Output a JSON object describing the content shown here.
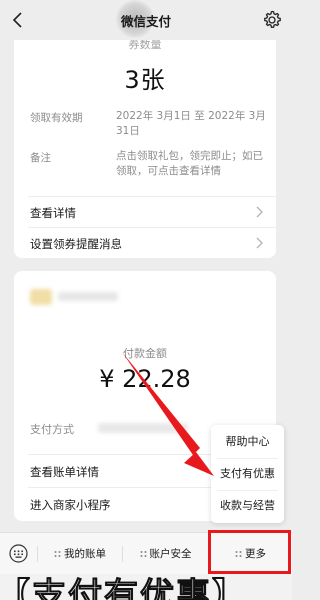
{
  "header": {
    "title": "微信支付",
    "back_icon": "chevron-left-icon",
    "settings_icon": "gear-icon"
  },
  "coupon_card": {
    "count_label": "券数量",
    "count_value": "3张",
    "validity_label": "领取有效期",
    "validity_value": "2022年 3月1日 至 2022年 3月31日",
    "note_label": "备注",
    "note_value": "点击领取礼包，领完即止；如已领取，可点击查看详情",
    "links": [
      {
        "label": "查看详情"
      },
      {
        "label": "设置领券提醒消息"
      }
    ]
  },
  "payment_card": {
    "amount_label": "付款金额",
    "amount_value": "¥ 22.28",
    "method_label": "支付方式",
    "links": [
      {
        "label": "查看账单详情"
      },
      {
        "label": "进入商家小程序"
      }
    ]
  },
  "popup_menu": {
    "items": [
      {
        "label": "帮助中心"
      },
      {
        "label": "支付有优惠"
      },
      {
        "label": "收款与经营"
      }
    ]
  },
  "bottom_bar": {
    "keyboard_icon": "keyboard-icon",
    "items": [
      {
        "label": "我的账单"
      },
      {
        "label": "账户安全"
      },
      {
        "label": "更多"
      }
    ]
  },
  "caption": {
    "text": "【支付有优惠】"
  },
  "colors": {
    "background": "#ededed",
    "highlight": "#e8191d",
    "arrow": "#e8191d"
  }
}
